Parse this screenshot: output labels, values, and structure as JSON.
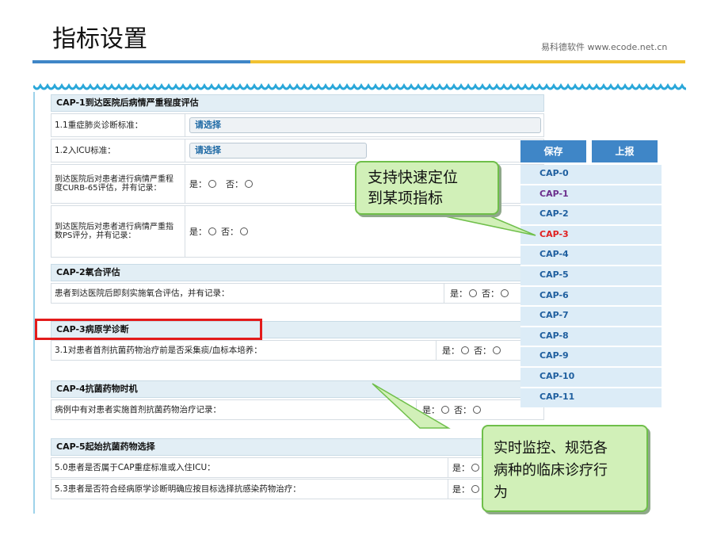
{
  "slide": {
    "title": "指标设置",
    "brand": "易科德软件  www.ecode.net.cn"
  },
  "sections": [
    {
      "heading": "CAP-1到达医院后病情严重程度评估",
      "rows": [
        {
          "label": "1.1重症肺炎诊断标准：",
          "select": "请选择"
        },
        {
          "label": "1.2入ICU标准：",
          "select": "请选择"
        },
        {
          "label": "到达医院后对患者进行病情严重程度CURB-65评估，并有记录：",
          "yes": "是：",
          "no": "否："
        },
        {
          "label": "到达医院后对患者进行病情严重指数PS评分，并有记录：",
          "yes": "是：",
          "no": "否："
        }
      ]
    },
    {
      "heading": "CAP-2氧合评估",
      "rows": [
        {
          "label": "患者到达医院后即刻实施氧合评估，并有记录：",
          "yes": "是：",
          "no": "否："
        }
      ]
    },
    {
      "heading": "CAP-3病原学诊断",
      "rows": [
        {
          "label": "3.1对患者首剂抗菌药物治疗前是否采集痰/血标本培养：",
          "yes": "是：",
          "no": "否："
        }
      ]
    },
    {
      "heading": "CAP-4抗菌药物时机",
      "rows": [
        {
          "label": "病例中有对患者实施首剂抗菌药物治疗记录：",
          "yes": "是：",
          "no": "否："
        }
      ]
    },
    {
      "heading": "CAP-5起始抗菌药物选择",
      "rows": [
        {
          "label": "5.0患者是否属于CAP重症标准或入住ICU：",
          "yes": "是："
        },
        {
          "label": "5.3患者是否符合经病原学诊断明确应按目标选择抗感染药物治疗：",
          "yes": "是："
        }
      ]
    }
  ],
  "actions": {
    "save": "保存",
    "report": "上报"
  },
  "cap_nav": [
    "CAP-0",
    "CAP-1",
    "CAP-2",
    "CAP-3",
    "CAP-4",
    "CAP-5",
    "CAP-6",
    "CAP-7",
    "CAP-8",
    "CAP-9",
    "CAP-10",
    "CAP-11"
  ],
  "cap_nav_state": {
    "visited": "CAP-1",
    "active": "CAP-3"
  },
  "callouts": {
    "quick_locate_line1": "支持快速定位",
    "quick_locate_line2": "到某项指标",
    "monitor_line1": "实时监控、规范各",
    "monitor_line2": "病种的临床诊疗行",
    "monitor_line3": "为"
  },
  "colors": {
    "accent_blue": "#3f86c7",
    "accent_gold": "#f1c232",
    "highlight_red": "#e31b1b",
    "callout_green": "#d1f0b8"
  }
}
